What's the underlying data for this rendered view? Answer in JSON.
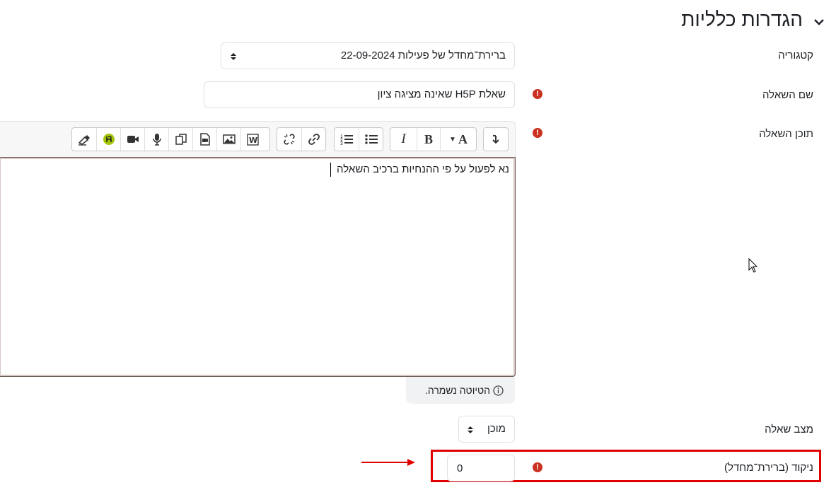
{
  "section": {
    "title": "הגדרות כלליות",
    "toggle_icon": "chevron-down-icon"
  },
  "category": {
    "label": "קטגוריה",
    "value": "ברירת־מחדל של פעילות 22-09-2024"
  },
  "question_name": {
    "label": "שם השאלה",
    "value": "שאלת H5P שאינה מציגה ציון",
    "required_icon": "exclamation-circle-icon"
  },
  "question_text": {
    "label": "תוכן השאלה",
    "required_icon": "exclamation-circle-icon",
    "content": "נא לפעול על פי ההנחיות ברכיב השאלה",
    "toolbar": {
      "bold_label": "B",
      "italic_label": "I",
      "font_label": "A",
      "icons": [
        "expand-toolbar-icon",
        "font-style-icon",
        "bold-icon",
        "italic-icon",
        "unordered-list-icon",
        "ordered-list-icon",
        "link-icon",
        "unlink-icon",
        "word-import-icon",
        "image-icon",
        "media-icon",
        "manage-files-icon",
        "record-audio-icon",
        "record-video-icon",
        "h5p-icon",
        "accessibility-checker-icon"
      ]
    }
  },
  "draft": {
    "text": "הטיוטה נשמרה.",
    "icon": "info-icon"
  },
  "question_status": {
    "label": "מצב שאלה",
    "value": "מוכן"
  },
  "default_mark": {
    "label": "ניקוד (ברירת־מחדל)",
    "value": "0",
    "required_icon": "exclamation-circle-icon"
  },
  "colors": {
    "required": "#ca3120",
    "highlight": "#e00000",
    "arrow": "#e00000"
  }
}
